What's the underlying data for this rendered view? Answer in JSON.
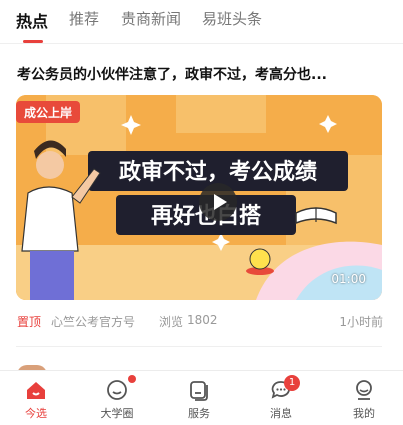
{
  "tabs": [
    {
      "label": "热点",
      "active": true
    },
    {
      "label": "推荐",
      "active": false
    },
    {
      "label": "贵商新闻",
      "active": false
    },
    {
      "label": "易班头条",
      "active": false
    }
  ],
  "accent_color": "#e8403c",
  "article": {
    "title": "考公务员的小伙伴注意了，政审不过，考高分也...",
    "cover": {
      "badge": "成公上岸",
      "headline_1": "政审不过，考公成绩",
      "headline_2": "再好也白搭",
      "duration": "01:00"
    },
    "pin_label": "置顶",
    "source": "心竺公考官方号",
    "views_label": "浏览",
    "views": "1802",
    "time": "1小时前"
  },
  "bottom_nav": [
    {
      "label": "今选",
      "icon": "home-icon",
      "active": true
    },
    {
      "label": "大学圈",
      "icon": "smile-icon",
      "dot": true
    },
    {
      "label": "服务",
      "icon": "cards-icon"
    },
    {
      "label": "消息",
      "icon": "chat-icon",
      "badge": "1"
    },
    {
      "label": "我的",
      "icon": "user-icon"
    }
  ]
}
